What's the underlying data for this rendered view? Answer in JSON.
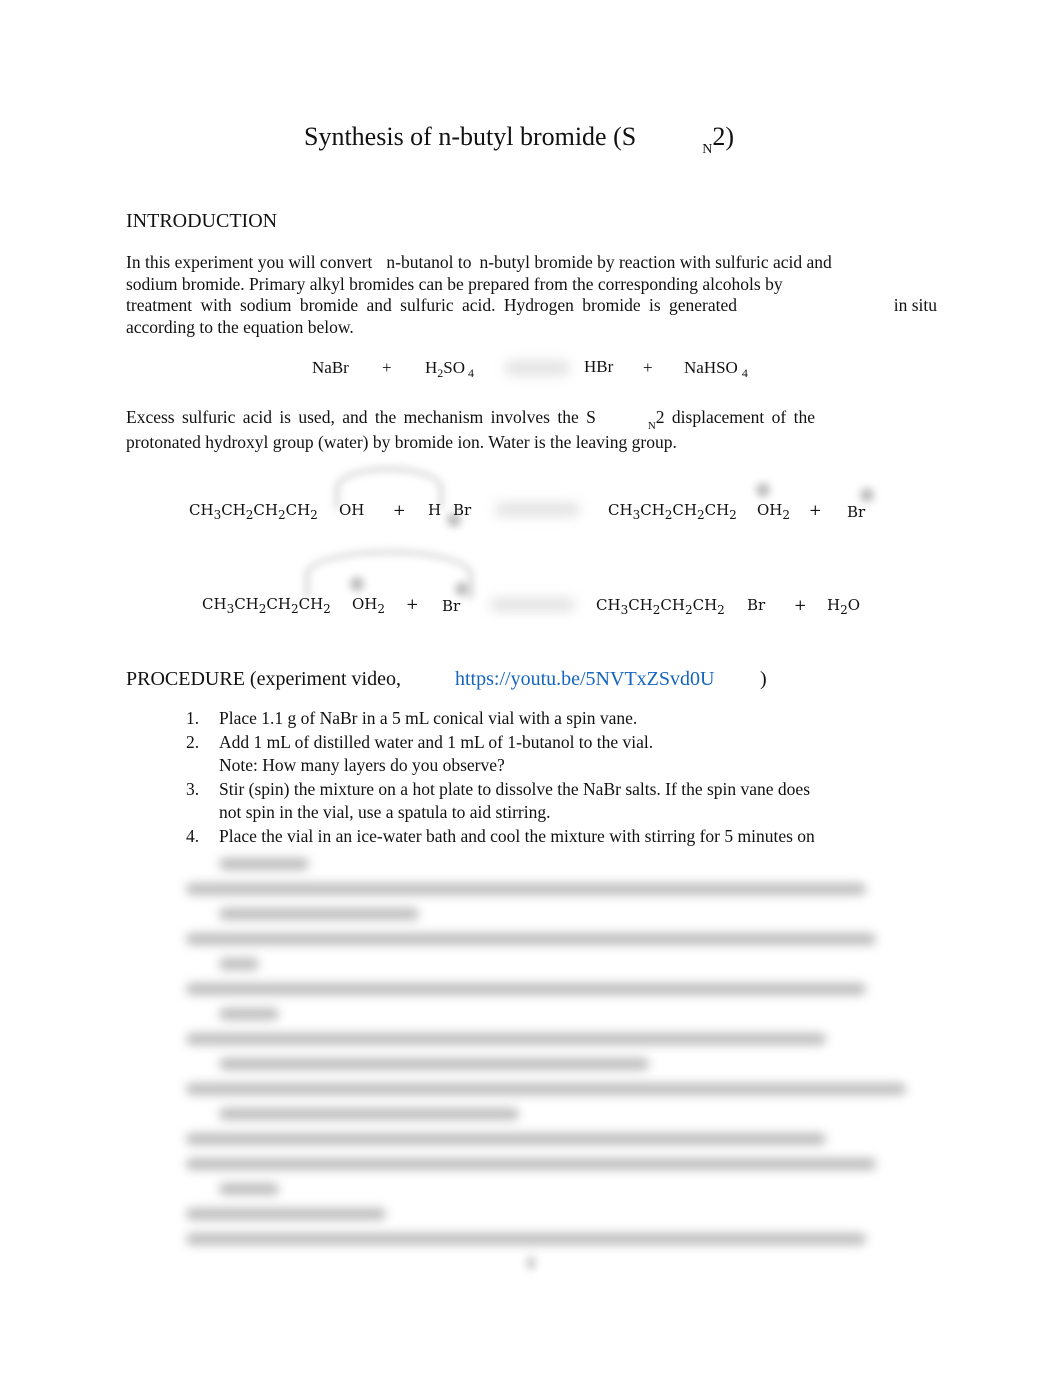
{
  "title": {
    "main": "Synthesis of n-butyl bromide (S",
    "subscript": "N",
    "suffix": "2)"
  },
  "introduction": {
    "heading": "INTRODUCTION",
    "paragraph1": {
      "line1_a": "In this experiment you will convert",
      "line1_b": "n-butanol to",
      "line1_c": "n-butyl bromide by reaction with sulfuric acid and",
      "line2": "sodium bromide. Primary alkyl bromides can be prepared from the corresponding alcohols by",
      "line3_a": "treatment with sodium bromide and sulfuric acid. Hydrogen bromide is generated",
      "line3_b": "in situ",
      "line4": "according to the equation below."
    },
    "equation": {
      "reactant1": "NaBr",
      "plus1": "+",
      "reactant2_h": "H",
      "reactant2_sub2": "2",
      "reactant2_so": "SO",
      "reactant2_sub4": "4",
      "product1": "HBr",
      "plus2": "+",
      "product2": "NaHSO",
      "product2_sub": "4"
    },
    "paragraph2": {
      "line1_a": "Excess sulfuric acid is used, and the mechanism involves the S",
      "line1_sub": "N",
      "line1_b": "2 displacement of the",
      "line2": "protonated hydroxyl group (water) by bromide ion. Water is the leaving group."
    }
  },
  "mechanism": {
    "step1": {
      "chain": [
        "CH",
        "3",
        "CH",
        "2",
        "CH",
        "2",
        "CH",
        "2"
      ],
      "group": "OH",
      "plus1": "+",
      "h": "H",
      "br": "Br",
      "product_chain": [
        "CH",
        "3",
        "CH",
        "2",
        "CH",
        "2",
        "CH",
        "2"
      ],
      "product_group": "OH",
      "product_group_sub": "2",
      "plus2": "+",
      "product_br": "Br"
    },
    "step2": {
      "chain": [
        "CH",
        "3",
        "CH",
        "2",
        "CH",
        "2",
        "CH",
        "2"
      ],
      "group": "OH",
      "group_sub": "2",
      "plus1": "+",
      "br": "Br",
      "product_chain": [
        "CH",
        "3",
        "CH",
        "2",
        "CH",
        "2",
        "CH",
        "2"
      ],
      "product_br": "Br",
      "plus2": "+",
      "water_h": "H",
      "water_sub": "2",
      "water_o": "O"
    }
  },
  "procedure": {
    "heading": "PROCEDURE (experiment video,",
    "link": "https://youtu.be/5NVTxZSvd0U",
    "close": ")",
    "steps": [
      {
        "num": "1.",
        "lines": [
          "Place 1.1 g of NaBr in a 5 mL conical vial with a spin vane."
        ]
      },
      {
        "num": "2.",
        "lines": [
          "Add 1 mL of distilled water and 1 mL of 1-butanol to the vial.",
          "Note: How many layers do you observe?"
        ]
      },
      {
        "num": "3.",
        "lines": [
          "Stir (spin) the mixture on a hot plate to dissolve the NaBr salts. If the spin vane does",
          "not spin in the vial, use a spatula to aid stirring."
        ]
      },
      {
        "num": "4.",
        "lines": [
          "Place the vial in an ice-water bath and cool the mixture with stirring for 5 minutes on"
        ]
      }
    ],
    "blurred_steps": [
      "5.",
      "6.",
      "7.",
      "8.",
      "9.",
      "10.",
      "11.",
      "12.",
      "13."
    ]
  }
}
